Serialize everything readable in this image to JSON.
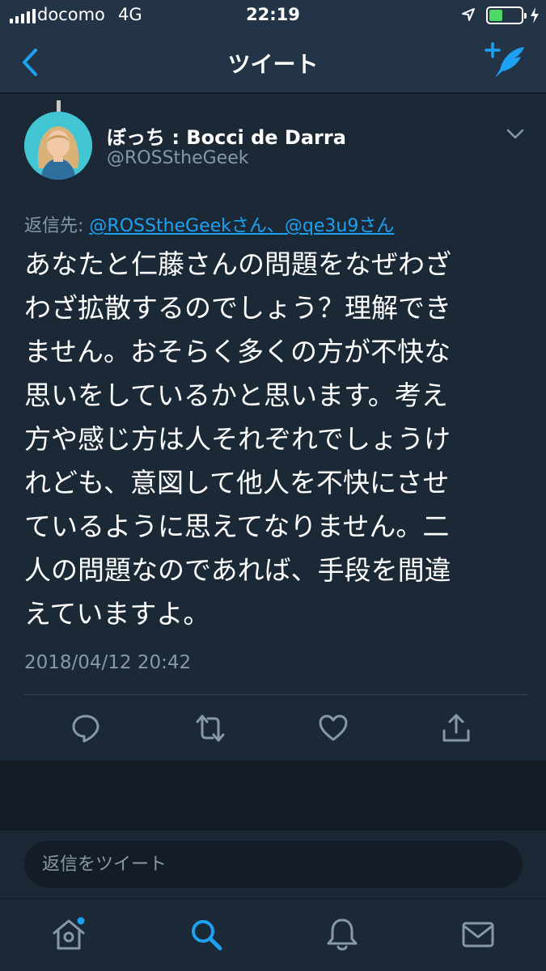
{
  "status_bar": {
    "carrier": "docomo",
    "network": "4G",
    "time": "22:19",
    "battery_level": 0.38,
    "icons": [
      "signal-bars-icon",
      "location-arrow-icon",
      "battery-icon",
      "charging-icon"
    ]
  },
  "nav": {
    "title": "ツイート",
    "back_icon": "chevron-left-icon",
    "compose_icon": "compose-tweet-icon"
  },
  "tweet": {
    "display_name": "ぼっち : Bocci de Darra",
    "handle": "@ROSStheGeek",
    "reply_to": {
      "prefix": "返信先: ",
      "targets": "@ROSStheGeekさん、@qe3u9さん"
    },
    "text": "あなたと仁藤さんの問題をなぜわざ\nわざ拡散するのでしょう？理解でき\nません。おそらく多くの方が不快な\n思いをしているかと思います。考え\n方や感じ方は人それぞれでしょうけ\nれども、意図して他人を不快にさせ\nているように思えてなりません。二\n人の問題なのであれば、手段を間違\nえていますよ。",
    "timestamp": "2018/04/12 20:42",
    "actions": [
      "reply-icon",
      "retweet-icon",
      "like-icon",
      "share-icon"
    ]
  },
  "reply_bar": {
    "placeholder": "返信をツイート"
  },
  "tab_bar": {
    "tabs": [
      "home-icon",
      "search-icon",
      "notifications-icon",
      "messages-icon"
    ],
    "active": "search",
    "colors": {
      "active": "#1da1f2",
      "inactive": "#8899a6"
    }
  },
  "colors": {
    "background": "#141d26",
    "surface": "#1b2836",
    "bar": "#243447",
    "accent": "#1da1f2",
    "secondary_text": "#8899a6"
  }
}
